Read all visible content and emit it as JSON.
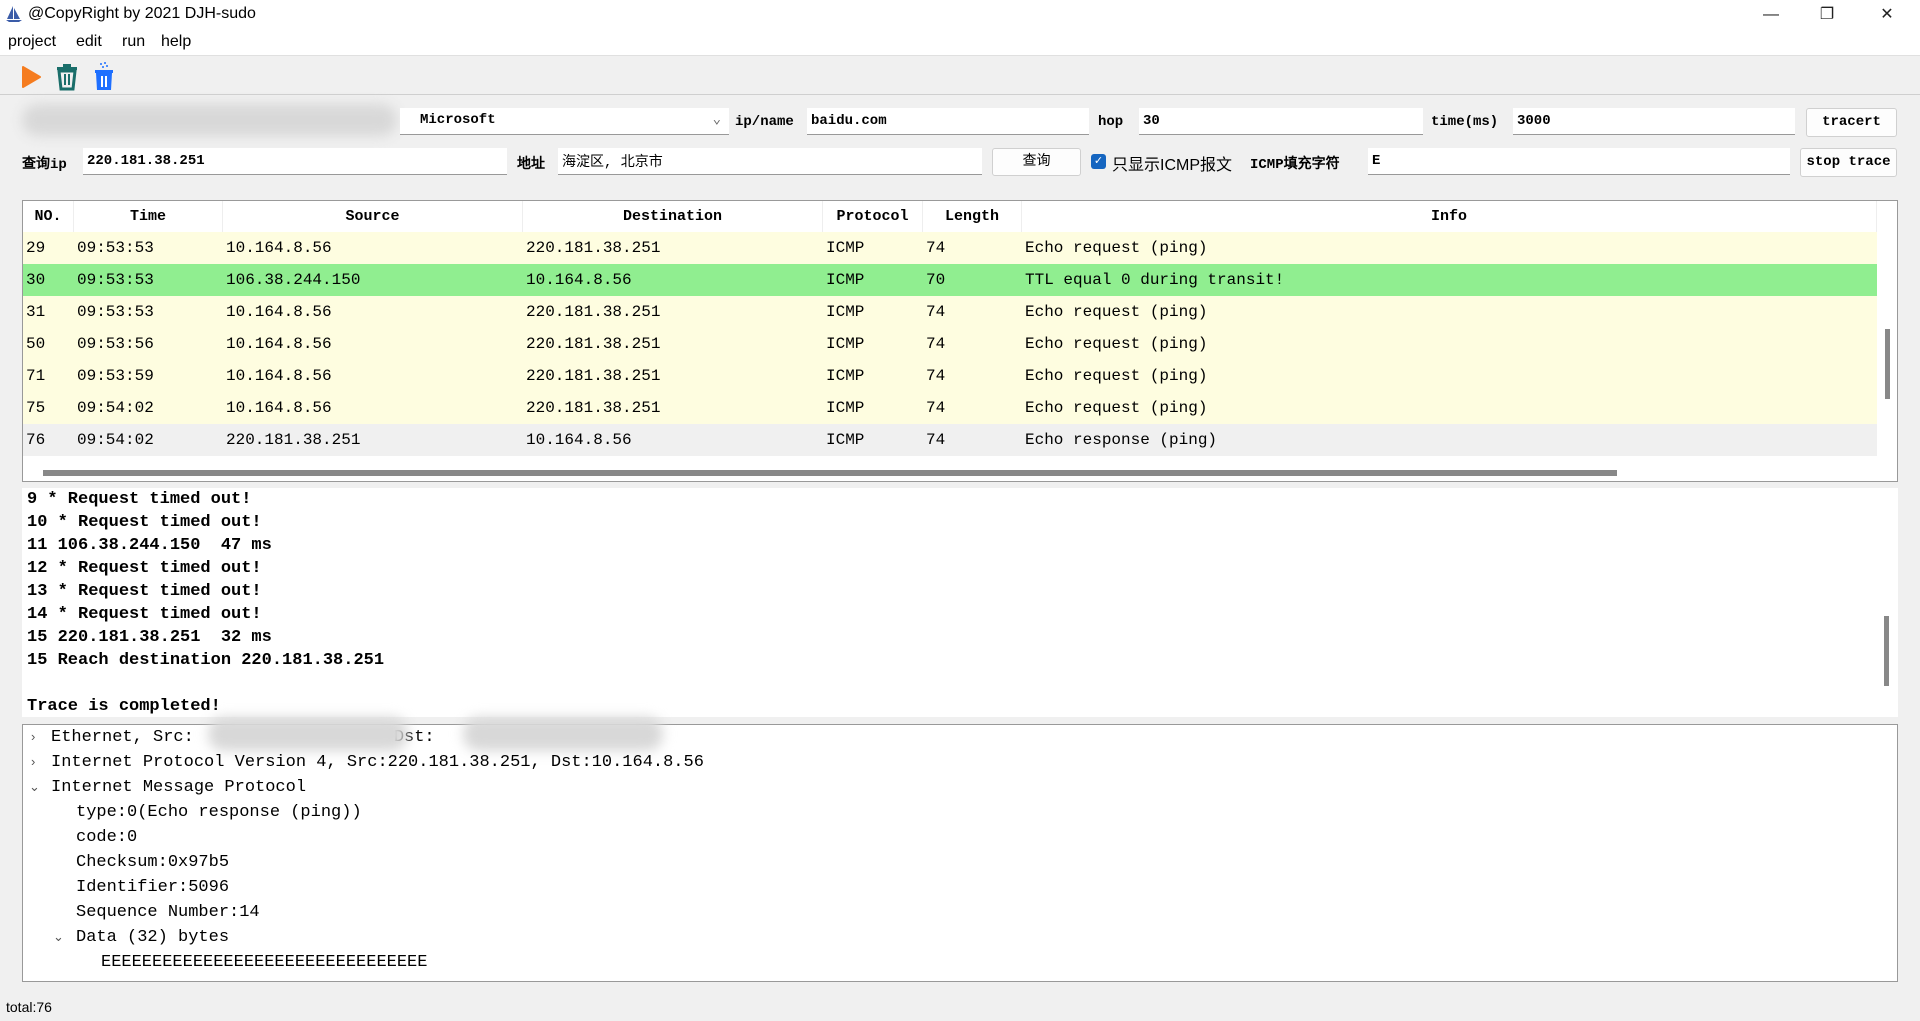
{
  "window": {
    "title": "@CopyRight by 2021 DJH-sudo",
    "minimize": "—",
    "restore": "❐",
    "close": "✕"
  },
  "menu": [
    "project",
    "edit",
    "run",
    "help"
  ],
  "toolbar": {
    "icons": [
      "play-icon",
      "trash-icon",
      "clear-icon"
    ],
    "colors": {
      "play": "#f57c1f",
      "trash": "#1a6e6a",
      "clear": "#1e6fff"
    }
  },
  "controls": {
    "adapter": "Microsoft",
    "ip_name_label": "ip/name",
    "ip_name_value": "baidu.com",
    "hop_label": "hop",
    "hop_value": "30",
    "time_label": "time(ms)",
    "time_value": "3000",
    "tracert": "tracert",
    "query_ip_label": "查询ip",
    "query_ip_value": "220.181.38.251",
    "address_label": "地址",
    "address_value": "海淀区, 北京市",
    "query_button": "查询",
    "icmp_only_label": "只显示ICMP报文",
    "icmp_only_checked": true,
    "fill_label": "ICMP填充字符",
    "fill_value": "E",
    "stop_trace": "stop trace"
  },
  "table": {
    "columns": [
      "NO.",
      "Time",
      "Source",
      "Destination",
      "Protocol",
      "Length",
      "Info"
    ],
    "rows": [
      {
        "cells": [
          "29",
          "09:53:53",
          "10.164.8.56",
          "220.181.38.251",
          "ICMP",
          "74",
          "Echo request (ping)"
        ],
        "color": "#fefde0"
      },
      {
        "cells": [
          "30",
          "09:53:53",
          "106.38.244.150",
          "10.164.8.56",
          "ICMP",
          "70",
          "TTL equal 0 during transit!"
        ],
        "color": "#90ee90"
      },
      {
        "cells": [
          "31",
          "09:53:53",
          "10.164.8.56",
          "220.181.38.251",
          "ICMP",
          "74",
          "Echo request (ping)"
        ],
        "color": "#fefde0"
      },
      {
        "cells": [
          "50",
          "09:53:56",
          "10.164.8.56",
          "220.181.38.251",
          "ICMP",
          "74",
          "Echo request (ping)"
        ],
        "color": "#fefde0"
      },
      {
        "cells": [
          "71",
          "09:53:59",
          "10.164.8.56",
          "220.181.38.251",
          "ICMP",
          "74",
          "Echo request (ping)"
        ],
        "color": "#fefde0"
      },
      {
        "cells": [
          "75",
          "09:54:02",
          "10.164.8.56",
          "220.181.38.251",
          "ICMP",
          "74",
          "Echo request (ping)"
        ],
        "color": "#fefde0"
      },
      {
        "cells": [
          "76",
          "09:54:02",
          "220.181.38.251",
          "10.164.8.56",
          "ICMP",
          "74",
          "Echo response (ping)"
        ],
        "color": "#f0f0f0"
      }
    ]
  },
  "log": [
    "9 * Request timed out!",
    "10 * Request timed out!",
    "11 106.38.244.150  47 ms",
    "12 * Request timed out!",
    "13 * Request timed out!",
    "14 * Request timed out!",
    "15 220.181.38.251  32 ms",
    "15 Reach destination 220.181.38.251",
    "",
    "Trace is completed!"
  ],
  "tree": {
    "ethernet_src": "Ethernet, Src:",
    "ethernet_dst": "Dst:",
    "ip": "Internet Protocol Version 4, Src:220.181.38.251, Dst:10.164.8.56",
    "icmp": "Internet Message Protocol",
    "fields": [
      "type:0(Echo response (ping))",
      "code:0",
      "Checksum:0x97b5",
      "Identifier:5096",
      "Sequence Number:14"
    ],
    "data": "Data (32) bytes",
    "data_value": "EEEEEEEEEEEEEEEEEEEEEEEEEEEEEEEE"
  },
  "status": "total:76"
}
